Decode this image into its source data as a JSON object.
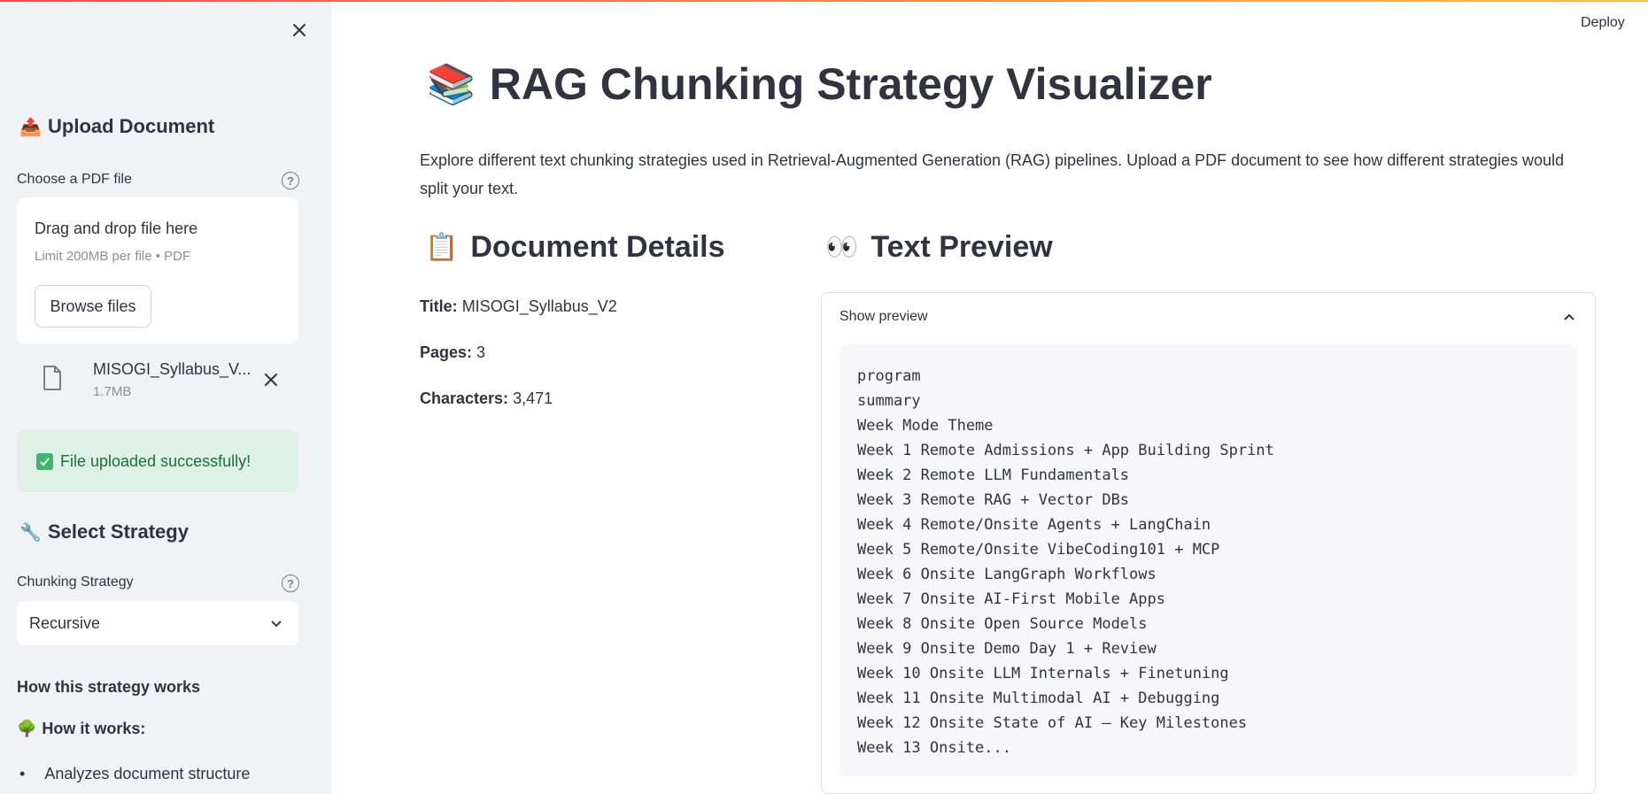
{
  "sidebar": {
    "upload_heading": "Upload Document",
    "upload_emoji": "📤",
    "file_label": "Choose a PDF file",
    "dropzone_title": "Drag and drop file here",
    "dropzone_limit": "Limit 200MB per file • PDF",
    "browse_label": "Browse files",
    "file_name": "MISOGI_Syllabus_V...",
    "file_size": "1.7MB",
    "success_message": "File uploaded successfully!",
    "strategy_heading": "Select Strategy",
    "strategy_emoji": "🔧",
    "strategy_label": "Chunking Strategy",
    "strategy_value": "Recursive",
    "how_heading": "How this strategy works",
    "how_subheading": "How it works:",
    "how_emoji": "🌳",
    "bullets": [
      "Analyzes document structure"
    ]
  },
  "header": {
    "deploy_label": "Deploy"
  },
  "main": {
    "title": "RAG Chunking Strategy Visualizer",
    "title_emoji": "📚",
    "intro": "Explore different text chunking strategies used in Retrieval-Augmented Generation (RAG) pipelines. Upload a PDF document to see how different strategies would split your text.",
    "details_heading": "Document Details",
    "details_emoji": "📋",
    "details": {
      "title_label": "Title:",
      "title_value": "MISOGI_Syllabus_V2",
      "pages_label": "Pages:",
      "pages_value": "3",
      "chars_label": "Characters:",
      "chars_value": "3,471"
    },
    "preview_heading": "Text Preview",
    "preview_emoji": "👀",
    "preview_toggle": "Show preview",
    "preview_lines": [
      "program",
      "summary",
      "Week Mode Theme",
      "Week 1 Remote Admissions + App Building Sprint",
      "Week 2 Remote LLM Fundamentals",
      "Week 3 Remote RAG + Vector DBs",
      "Week 4 Remote/Onsite Agents + LangChain",
      "Week 5 Remote/Onsite VibeCoding101 + MCP",
      "Week 6 Onsite LangGraph Workflows",
      "Week 7 Onsite AI-First Mobile Apps",
      "Week 8 Onsite Open Source Models",
      "Week 9 Onsite Demo Day 1 + Review",
      "Week 10 Onsite LLM Internals + Finetuning",
      "Week 11 Onsite Multimodal AI + Debugging",
      "Week 12 Onsite State of AI – Key Milestones",
      "Week 13 Onsite..."
    ]
  },
  "colors": {
    "accent": "#ff4b4b",
    "success_bg": "#dff0e6",
    "success_text": "#177233",
    "sidebar_bg": "#f0f2f6"
  }
}
